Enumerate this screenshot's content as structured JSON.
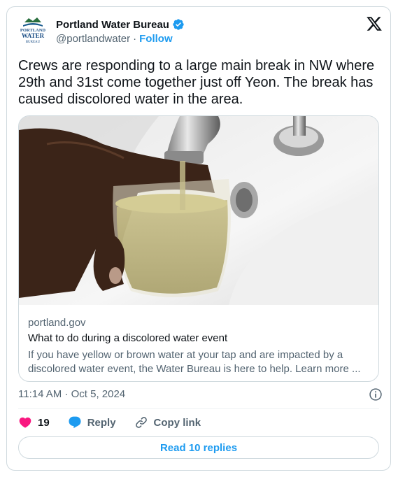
{
  "header": {
    "display_name": "Portland Water Bureau",
    "handle": "@portlandwater",
    "separator": "·",
    "follow_label": "Follow",
    "avatar_text": {
      "line1": "PORTLAND",
      "line2": "WATER",
      "line3": "BUREAU"
    }
  },
  "tweet": {
    "text": "Crews are responding to a large main break in NW where 29th and 31st come together just off Yeon. The break has caused discolored water in the area."
  },
  "link_card": {
    "domain": "portland.gov",
    "title": "What to do during a discolored water event",
    "description": "If you have yellow or brown water at your tap and are impacted by a discolored water event, the Water Bureau is here to help. Learn more ..."
  },
  "timestamp": "11:14 AM · Oct 5, 2024",
  "actions": {
    "like_count": "19",
    "reply_label": "Reply",
    "copy_link_label": "Copy link"
  },
  "read_replies_label": "Read 10 replies",
  "colors": {
    "accent": "#1d9bf0",
    "like": "#f91880",
    "text_primary": "#0f1419",
    "text_secondary": "#536471",
    "border": "#cfd9de"
  },
  "icons": [
    "verified-icon",
    "x-logo-icon",
    "info-icon",
    "heart-icon",
    "reply-icon",
    "link-icon"
  ]
}
